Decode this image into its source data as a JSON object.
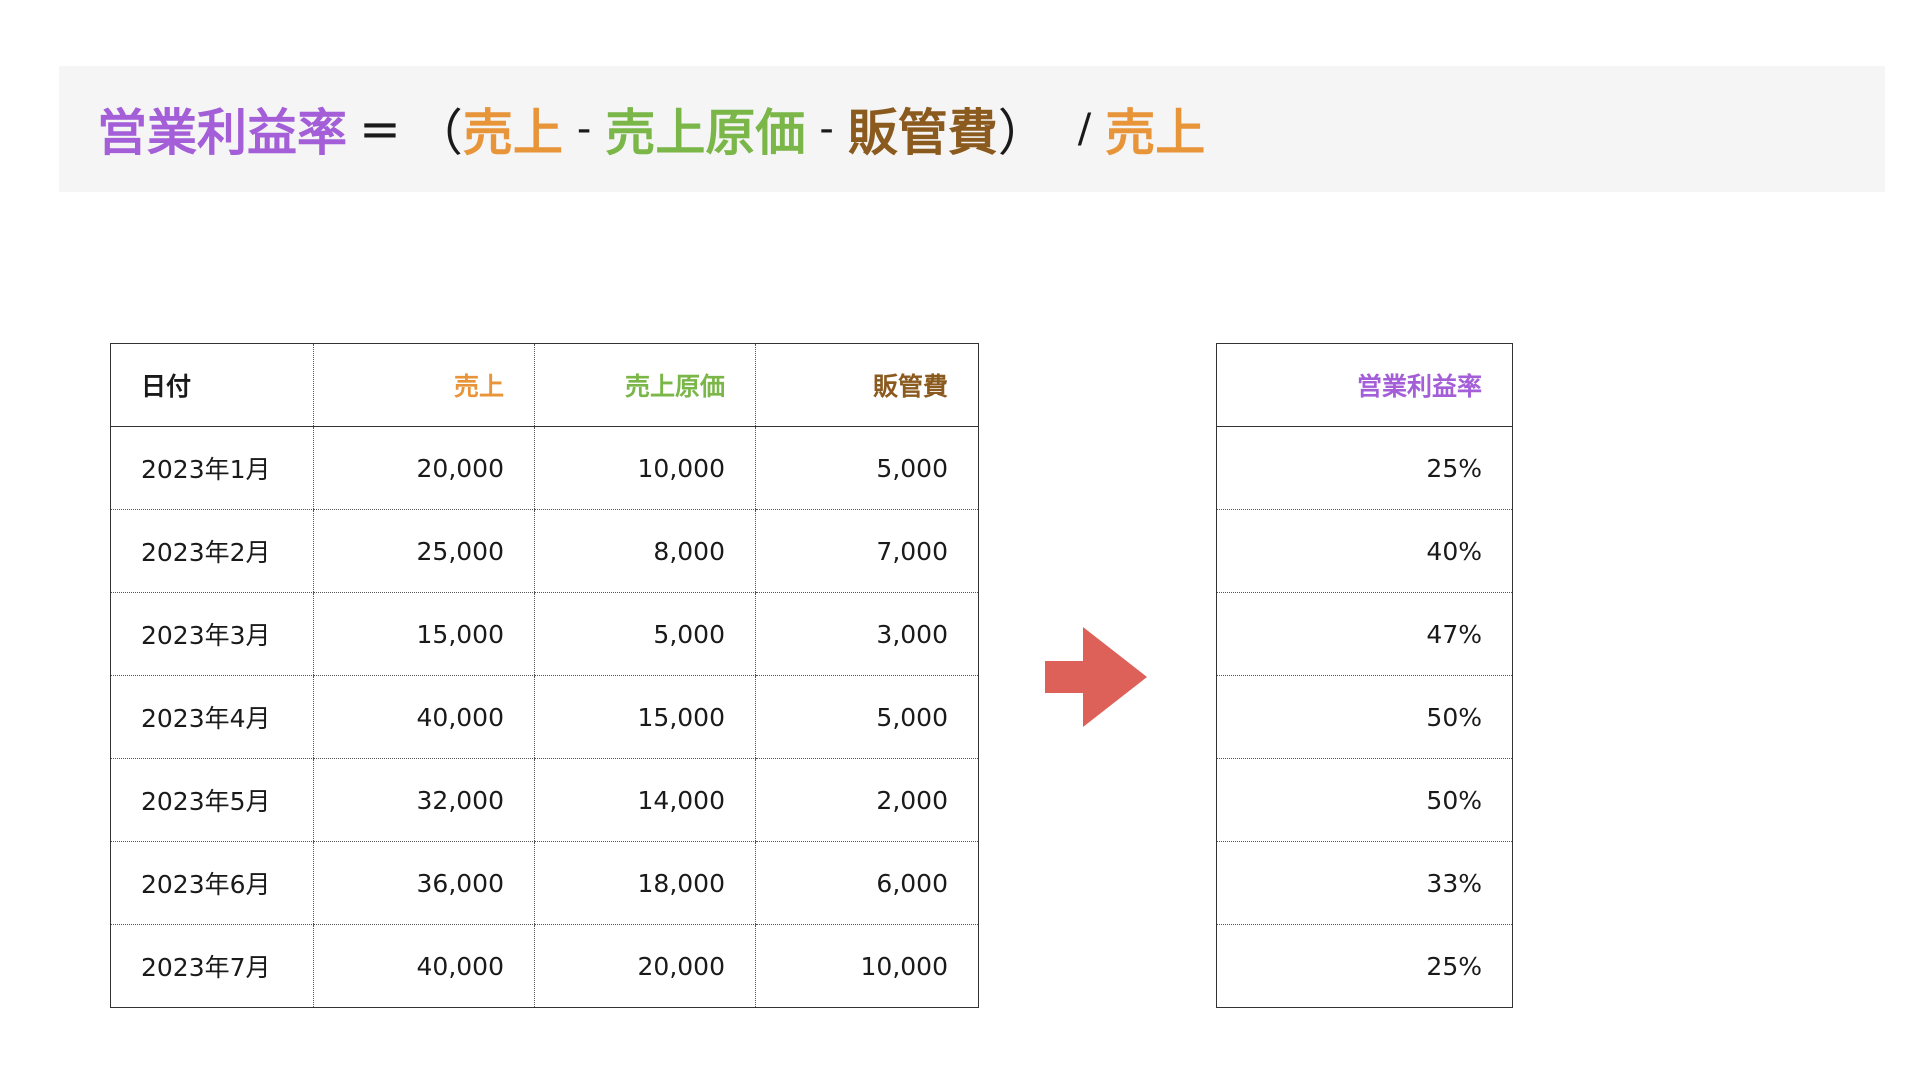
{
  "formula": {
    "result": "営業利益率",
    "equals": "=",
    "open_paren": "（",
    "term1": "売上",
    "minus1": "-",
    "term2": "売上原価",
    "minus2": "-",
    "term3": "販管費",
    "close_paren": "）",
    "divide": "/",
    "term4": "売上"
  },
  "colors": {
    "sales": "#e8953a",
    "cost": "#7ab648",
    "sga": "#8b5a1e",
    "margin": "#a35ed8",
    "arrow": "#dd6158",
    "banner_bg": "#f5f5f5"
  },
  "main_table": {
    "headers": [
      "日付",
      "売上",
      "売上原価",
      "販管費"
    ],
    "rows": [
      [
        "2023年1月",
        "20,000",
        "10,000",
        "5,000"
      ],
      [
        "2023年2月",
        "25,000",
        "8,000",
        "7,000"
      ],
      [
        "2023年3月",
        "15,000",
        "5,000",
        "3,000"
      ],
      [
        "2023年4月",
        "40,000",
        "15,000",
        "5,000"
      ],
      [
        "2023年5月",
        "32,000",
        "14,000",
        "2,000"
      ],
      [
        "2023年6月",
        "36,000",
        "18,000",
        "6,000"
      ],
      [
        "2023年7月",
        "40,000",
        "20,000",
        "10,000"
      ]
    ]
  },
  "result_table": {
    "header": "営業利益率",
    "values": [
      "25%",
      "40%",
      "47%",
      "50%",
      "50%",
      "33%",
      "25%"
    ]
  },
  "arrow_icon": "right-arrow-icon"
}
